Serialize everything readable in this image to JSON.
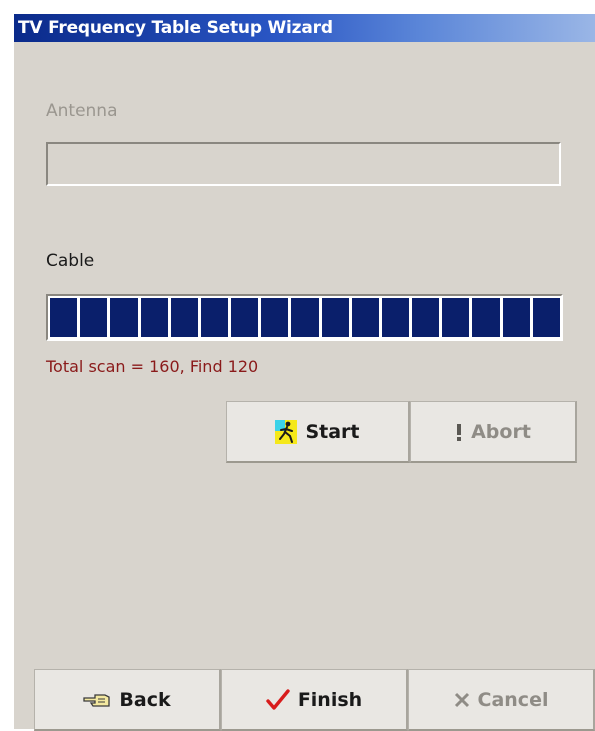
{
  "window": {
    "title": "TV Frequency Table Setup Wizard"
  },
  "antenna": {
    "label": "Antenna",
    "progress": 0
  },
  "cable": {
    "label": "Cable",
    "progress": 1.0,
    "segment_count": 17,
    "segment_color": "#0a1f6b",
    "status": "Total scan = 160, Find 120"
  },
  "scan_buttons": {
    "start": {
      "label": "Start",
      "icon": "running-man-icon"
    },
    "abort": {
      "label": "Abort",
      "icon": "exclamation-icon",
      "enabled": false
    }
  },
  "nav_buttons": {
    "back": {
      "label": "Back",
      "icon": "pointing-hand-icon"
    },
    "finish": {
      "label": "Finish",
      "icon": "checkmark-icon"
    },
    "cancel": {
      "label": "Cancel",
      "icon": "x-icon",
      "enabled": false
    }
  },
  "colors": {
    "title_gradient_start": "#0a2a8a",
    "title_gradient_end": "#9ab6e6",
    "status_text": "#8a1a1a",
    "window_bg": "#d8d4cd"
  }
}
